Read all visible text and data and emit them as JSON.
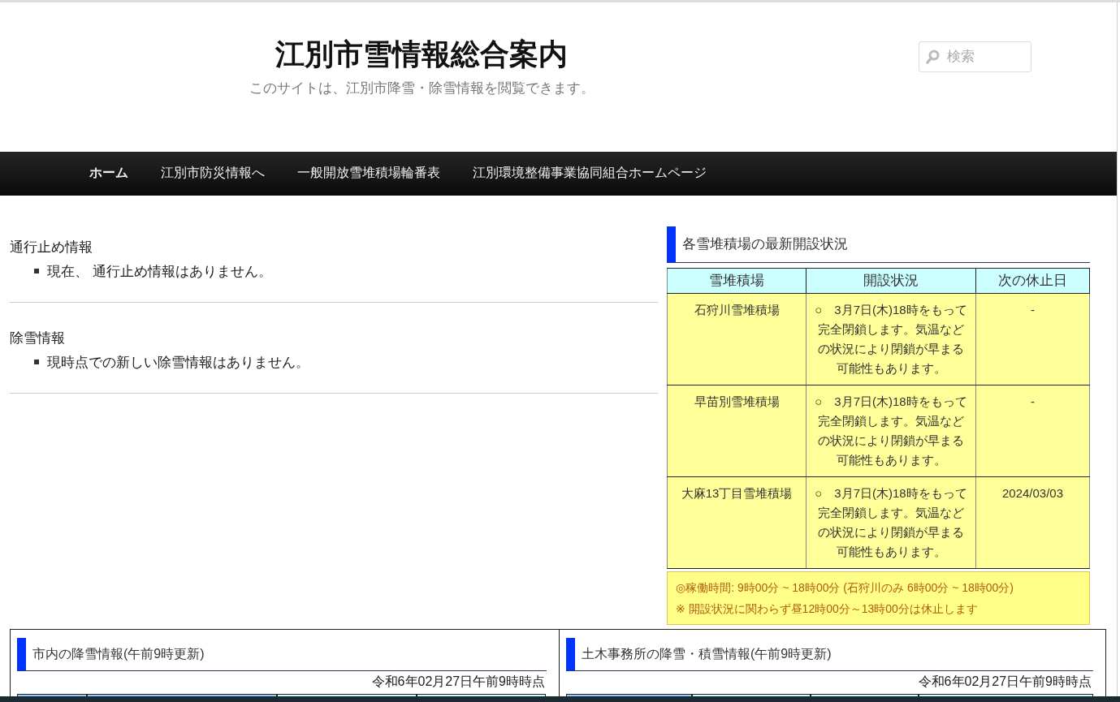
{
  "site": {
    "title": "江別市雪情報総合案内",
    "tagline": "このサイトは、江別市降雪・除雪情報を閲覧できます。",
    "search_placeholder": "検索"
  },
  "nav": [
    {
      "label": "ホーム",
      "selected": true
    },
    {
      "label": "江別市防災情報へ",
      "selected": false
    },
    {
      "label": "一般開放雪堆積場輪番表",
      "selected": false
    },
    {
      "label": "江別環境整備事業協同組合ホームページ",
      "selected": false
    }
  ],
  "notices": [
    {
      "heading": "通行止め情報",
      "items": [
        "現在、 通行止め情報はありません。"
      ]
    },
    {
      "heading": "除雪情報",
      "items": [
        "現時点での新しい除雪情報はありません。"
      ]
    }
  ],
  "snow_sites": {
    "heading": "各雪堆積場の最新開設状況",
    "columns": [
      "雪堆積場",
      "開設状況",
      "次の休止日"
    ],
    "rows": [
      {
        "site": "石狩川雪堆積場",
        "status": "○　3月7日(木)18時をもって完全閉鎖します。気温などの状況により閉鎖が早まる可能性もあります。",
        "next_closure": "-"
      },
      {
        "site": "早苗別雪堆積場",
        "status": "○　3月7日(木)18時をもって完全閉鎖します。気温などの状況により閉鎖が早まる可能性もあります。",
        "next_closure": "-"
      },
      {
        "site": "大麻13丁目雪堆積場",
        "status": "○　3月7日(木)18時をもって完全閉鎖します。気温などの状況により閉鎖が早まる可能性もあります。",
        "next_closure": "2024/03/03"
      }
    ],
    "notes": [
      "◎稼働時間: 9時00分 ~ 18時00分 (石狩川のみ 6時00分 ~ 18時00分)",
      "※ 開設状況に関わらず昼12時00分～13時00分は休止します"
    ]
  },
  "panels": [
    {
      "heading": "市内の降雪情報(午前9時更新)",
      "timestamp": "令和6年02月27日午前9時時点"
    },
    {
      "heading": "土木事務所の降雪・積雪情報(午前9時更新)",
      "timestamp": "令和6年02月27日午前9時時点"
    }
  ]
}
